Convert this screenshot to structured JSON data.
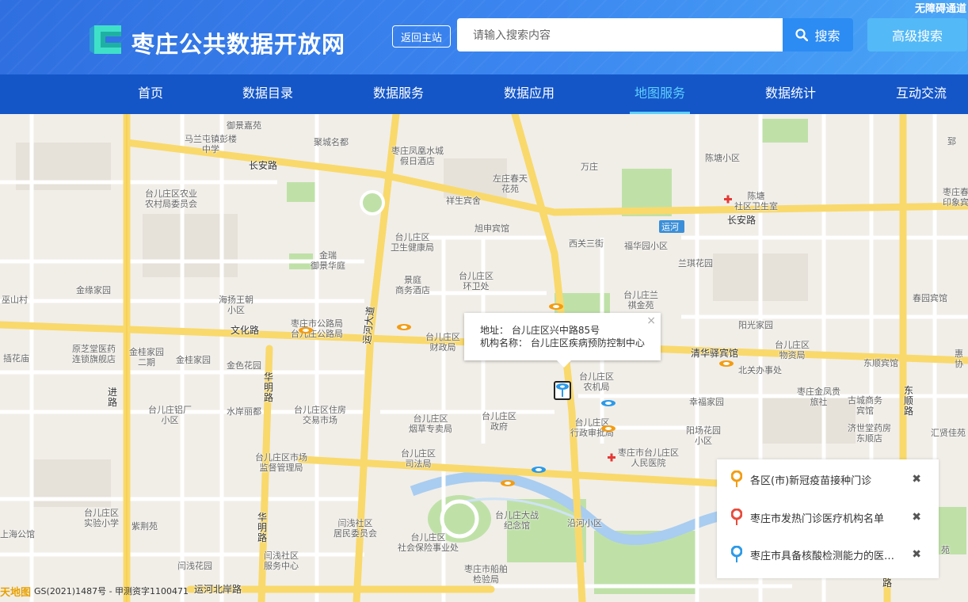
{
  "header": {
    "accessibility_link": "无障碍通道",
    "site_title": "枣庄公共数据开放网",
    "back_button": "返回主站",
    "search_placeholder": "请输入搜索内容",
    "search_button": "搜索",
    "advanced_search_button": "高级搜索"
  },
  "nav": {
    "items": [
      {
        "label": "首页"
      },
      {
        "label": "数据目录"
      },
      {
        "label": "数据服务"
      },
      {
        "label": "数据应用"
      },
      {
        "label": "地图服务",
        "active": true
      },
      {
        "label": "数据统计"
      },
      {
        "label": "互动交流"
      }
    ]
  },
  "map": {
    "labels": {
      "yujingjiayuan": "御景嘉苑",
      "malanzhen": "马兰屯镇彭楼\n中学",
      "changanlu_w": "长安路",
      "juchengmingdu": "聚城名都",
      "fenghuang": "枣庄凤凰水城\n假日酒店",
      "wanzhuang": "万庄",
      "zuozhuang": "左庄春天\n花苑",
      "chentang": "陈塘小区",
      "zao": "郅",
      "nongye": "台儿庄区农业\n农村局委员会",
      "xiangsheng": "祥生宾舍",
      "chentang_clinic": "陈塘\n社区卫生室",
      "zaozhuang_yinxiang": "枣庄春\n印象宾",
      "yunhe": "运河",
      "changanlu_e": "长安路",
      "xushen": "旭申宾馆",
      "xiguan": "西关三街",
      "fuyuan": "福华园小区",
      "weishen": "台儿庄区\n卫生健康局",
      "jinrui": "金瑞\n御景华庭",
      "lanqi": "兰琪花园",
      "jingting": "景庭\n商务酒店",
      "huanwei": "台儿庄区\n环卫处",
      "jinyuan": "金缘家园",
      "haiyang": "海扬王朝\n小区",
      "wushan": "巫山村",
      "lanshe": "台儿庄兰\n祺金苑",
      "chunyuan": "春园宾馆",
      "wenhualu": "文化路",
      "gonglu": "枣庄市公路局\n台儿庄公路局",
      "caizheng": "台儿庄区\n财政局",
      "yangguang": "阳光家园",
      "yaodian": "原芝堂医药\n连锁旗舰店",
      "jingui2": "金桂家园\n二期",
      "jingui": "金桂家园",
      "jinse": "金色花园",
      "yunhe_dadao": "运河大道",
      "qingjie": "清华驿宾馆",
      "wuzi": "台儿庄区\n物资局",
      "dongshun": "东顺宾馆",
      "chahuamiao": "插花庙",
      "nongji": "台儿庄区\n农机局",
      "beiguan": "北关办事处",
      "jinfeng": "枣庄金凤贵\n旅社",
      "gucheng": "古城商务\n宾馆",
      "dongshunlu": "东\n顺\n路",
      "lvchang": "台儿庄铝厂\n小区",
      "huamin": "华\n明\n路",
      "shuian": "水岸丽都",
      "zhufang": "台儿庄区住房\n交易市场",
      "xinglu": "进\n路",
      "yancao": "台儿庄区\n烟草专卖局",
      "zhengfu": "台儿庄区\n政府",
      "xingzheng": "台儿庄区\n行政审批局",
      "xingfu": "幸福家园",
      "yangchang": "阳场花园\n小区",
      "jishi": "济世堂药房\n东顺店",
      "huiyue": "汇贤佳苑",
      "shichang": "台儿庄区市场\n监督管理局",
      "sifa": "台儿庄区\n司法局",
      "renmin": "枣庄市台儿庄区\n人民医院",
      "shiyan": "台儿庄区\n实验小学",
      "zijing": "紫荆苑",
      "shanghai": "上海公馆",
      "huamin2": "华\n明\n路",
      "yanqian": "闫浅社区\n居民委员会",
      "dazhan": "台儿庄大战\n纪念馆",
      "yanhe": "沿河小区",
      "shebao": "台儿庄区\n社会保险事业处",
      "yanqian2": "闫浅社区\n服务中心",
      "yanqianhuayuan": "闫浅花园",
      "chuanbo": "枣庄市船舶\n检验局",
      "beianlu": "运河北岸路",
      "huiyi": "惠\n协",
      "lu": "路",
      "heyuan": "苑"
    }
  },
  "popup": {
    "address": "地址： 台儿庄区兴中路85号",
    "org": "机构名称： 台儿庄区疾病预防控制中心",
    "close": "×"
  },
  "legend": {
    "items": [
      {
        "label": "各区(市)新冠疫苗接种门诊",
        "color": "#f39c12"
      },
      {
        "label": "枣庄市发热门诊医疗机构名单",
        "color": "#e74c3c"
      },
      {
        "label": "枣庄市具备核酸检测能力的医疗机构",
        "color": "#2c9ae8"
      }
    ],
    "close": "✖"
  },
  "copyright": {
    "brand": "天地图",
    "text": "GS(2021)1487号 - 甲测资字1100471"
  },
  "colors": {
    "header_blue": "#2f6fe0",
    "nav_blue": "#1456c8",
    "active_nav": "#5fd0ff",
    "road_yellow": "#f9d96b",
    "green": "#b9dca2",
    "water": "#a9cdf0"
  }
}
